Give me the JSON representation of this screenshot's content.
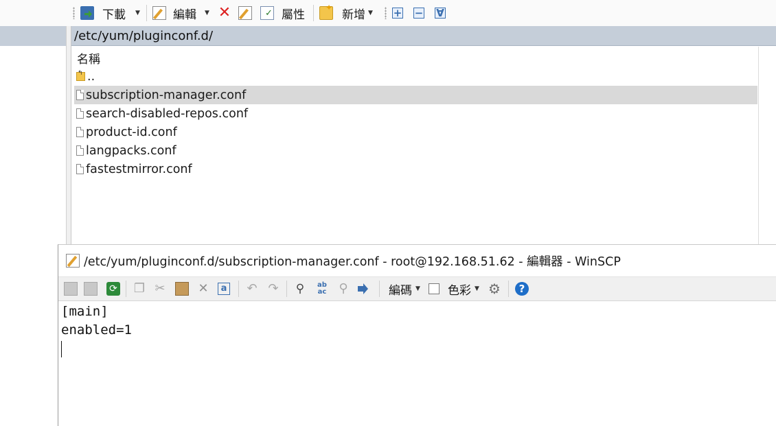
{
  "toolbar": {
    "download_label": "下載",
    "edit_label": "編輯",
    "properties_label": "屬性",
    "new_label": "新增"
  },
  "path_bar": {
    "path": "/etc/yum/pluginconf.d/"
  },
  "file_list": {
    "column_name": "名稱",
    "parent_dir": "..",
    "files": [
      "subscription-manager.conf",
      "search-disabled-repos.conf",
      "product-id.conf",
      "langpacks.conf",
      "fastestmirror.conf"
    ],
    "selected_index": 0
  },
  "editor": {
    "title": "/etc/yum/pluginconf.d/subscription-manager.conf - root@192.168.51.62 - 編輯器 - WinSCP",
    "encoding_label": "編碼",
    "color_label": "色彩",
    "lines": [
      "[main]",
      "enabled=1"
    ]
  }
}
